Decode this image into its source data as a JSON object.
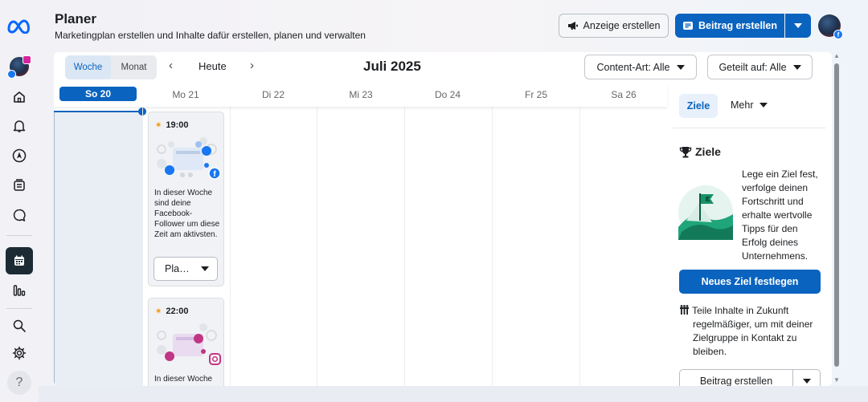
{
  "app": {
    "brand_icon": "meta-logo-icon"
  },
  "header": {
    "title": "Planer",
    "subtitle": "Marketingplan erstellen und Inhalte dafür erstellen, planen und verwalten",
    "create_ad_label": "Anzeige erstellen",
    "create_post_label": "Beitrag erstellen"
  },
  "rail": {
    "items": [
      {
        "name": "profile-avatar",
        "icon": "avatar"
      },
      {
        "name": "home",
        "icon": "home-icon"
      },
      {
        "name": "notifications",
        "icon": "bell-icon"
      },
      {
        "name": "ads",
        "icon": "navigation-arrow-icon"
      },
      {
        "name": "content",
        "icon": "content-stack-icon"
      },
      {
        "name": "inbox",
        "icon": "chat-bubble-icon"
      },
      {
        "name": "planner",
        "icon": "calendar-icon",
        "active": true
      },
      {
        "name": "insights",
        "icon": "bar-chart-icon"
      },
      {
        "name": "search",
        "icon": "search-icon"
      },
      {
        "name": "settings",
        "icon": "gear-icon"
      },
      {
        "name": "help",
        "icon": "question-icon"
      }
    ],
    "help_glyph": "?"
  },
  "calendar": {
    "view_week": "Woche",
    "view_month": "Monat",
    "today_label": "Heute",
    "month_label": "Juli 2025",
    "prev_glyph": "‹",
    "next_glyph": "›",
    "filter_content_type": "Content-Art: Alle",
    "filter_shared_on": "Geteilt auf: Alle",
    "days": [
      "So 20",
      "Mo 21",
      "Di 22",
      "Mi 23",
      "Do 24",
      "Fr 25",
      "Sa 26"
    ],
    "slots": [
      {
        "time": "19:00",
        "platform": "facebook",
        "text": "In dieser Woche sind deine Facebook-Follower um diese Zeit am aktivsten.",
        "button": "Pla…"
      },
      {
        "time": "22:00",
        "platform": "instagram",
        "text": "In dieser Woche"
      }
    ]
  },
  "panel": {
    "tab_goals": "Ziele",
    "tab_more": "Mehr",
    "goals_heading": "Ziele",
    "goals_text": "Lege ein Ziel fest, verfolge deinen Fortschritt und erhalte wertvolle Tipps für den Erfolg deines Unternehmens.",
    "set_goal_button": "Neues Ziel festlegen",
    "share_text_line1": "Teile Inhalte in Zukunft",
    "share_text_line2": "regelmäßiger, um mit deiner Zielgruppe in Kontakt zu bleiben.",
    "create_post_button": "Beitrag erstellen"
  },
  "colors": {
    "accent": "#0a63bf",
    "rail_active": "#1c2b33",
    "today_column": "#e9eef5",
    "facebook": "#1877f2",
    "instagram": "#c13584"
  }
}
